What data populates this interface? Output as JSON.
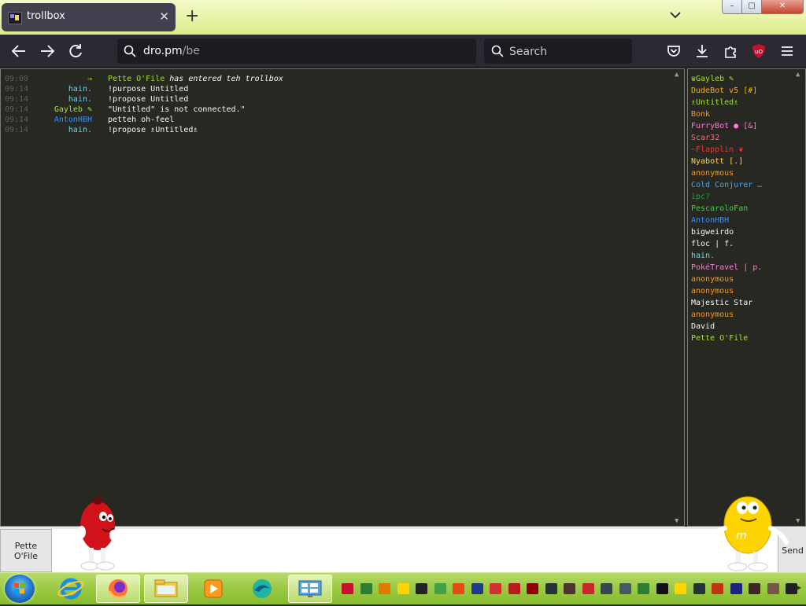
{
  "browser": {
    "tab": {
      "title": "trollbox",
      "favicon": "trollbox-favicon-icon"
    },
    "new_tab_symbol": "+",
    "url": {
      "host": "dro.pm",
      "path": "/be"
    },
    "search": {
      "placeholder": "Search"
    },
    "window_controls": {
      "minimize": "–",
      "maximize": "▢",
      "close": "✕"
    },
    "colors": {
      "tabbar": "#e8f3a6",
      "toolbar": "#2b2a33",
      "field": "#1c1b22"
    }
  },
  "chat": {
    "messages": [
      {
        "time": "09:08",
        "nick": "→",
        "text": "Pette O'File has entered teh trollbox",
        "nick_color": "#a6e22e",
        "system": true
      },
      {
        "time": "09:14",
        "nick": "hain.",
        "text": "!purpose Untitled",
        "nick_color": "#66d9ef"
      },
      {
        "time": "09:14",
        "nick": "hain.",
        "text": "!propose Untitled",
        "nick_color": "#66d9ef"
      },
      {
        "time": "09:14",
        "nick": "Gayleb ✎",
        "text": "\"Untitled\" is not connected.\"",
        "nick_color": "#a6e22e"
      },
      {
        "time": "09:14",
        "nick": "AntonHBH",
        "text": "petteh oh-feel",
        "nick_color": "#2f8fff"
      },
      {
        "time": "09:14",
        "nick": "hain.",
        "text": "!propose ♗Untitled♗",
        "nick_color": "#66d9ef"
      }
    ],
    "users": [
      {
        "name": "♛Gayleb ✎",
        "color": "#a6e22e"
      },
      {
        "name": "DudeBot v5 [#]",
        "color": "#ffb000"
      },
      {
        "name": "♗Untitled♗",
        "color": "#a6e22e"
      },
      {
        "name": "Bonk",
        "color": "#fd971f"
      },
      {
        "name": "FurryBot ● [&]",
        "color": "#ff7ad9"
      },
      {
        "name": "Scar32",
        "color": "#ff6b8b"
      },
      {
        "name": "~Flapplin ❦",
        "color": "#ff3030"
      },
      {
        "name": "Nyabott [.]",
        "color": "#ffd84a"
      },
      {
        "name": "anonymous",
        "color": "#fd971f"
      },
      {
        "name": "Cold Conjurer …",
        "color": "#3fa6ff"
      },
      {
        "name": "ipc?",
        "color": "#2f9e2f"
      },
      {
        "name": "PescaroloFan",
        "color": "#36d936"
      },
      {
        "name": "AntonHBH",
        "color": "#2f8fff"
      },
      {
        "name": "bigweirdo",
        "color": "#f8f8f2"
      },
      {
        "name": "floc | f.",
        "color": "#f8f8f2"
      },
      {
        "name": "hain.",
        "color": "#66d9ef"
      },
      {
        "name": "PokéTravel | p.",
        "color": "#ff7ad9"
      },
      {
        "name": "anonymous",
        "color": "#fd971f"
      },
      {
        "name": "anonymous",
        "color": "#fd971f"
      },
      {
        "name": "Majestic Star",
        "color": "#f8f8f2"
      },
      {
        "name": "anonymous",
        "color": "#fd971f"
      },
      {
        "name": "David",
        "color": "#f8f8f2"
      },
      {
        "name": "Pette O'File",
        "color": "#a6e22e"
      }
    ],
    "nick_button": {
      "line1": "Pette",
      "line2": "O'File"
    },
    "send_label": "Send",
    "mascots": [
      "red-mm-mascot-icon",
      "yellow-mm-mascot-icon"
    ]
  },
  "taskbar": {
    "pinned": [
      "windows-start-icon",
      "internet-explorer-icon",
      "firefox-icon",
      "file-explorer-icon",
      "media-player-icon",
      "edge-globe-icon",
      "control-panel-icon"
    ],
    "tray_icons": 25
  }
}
